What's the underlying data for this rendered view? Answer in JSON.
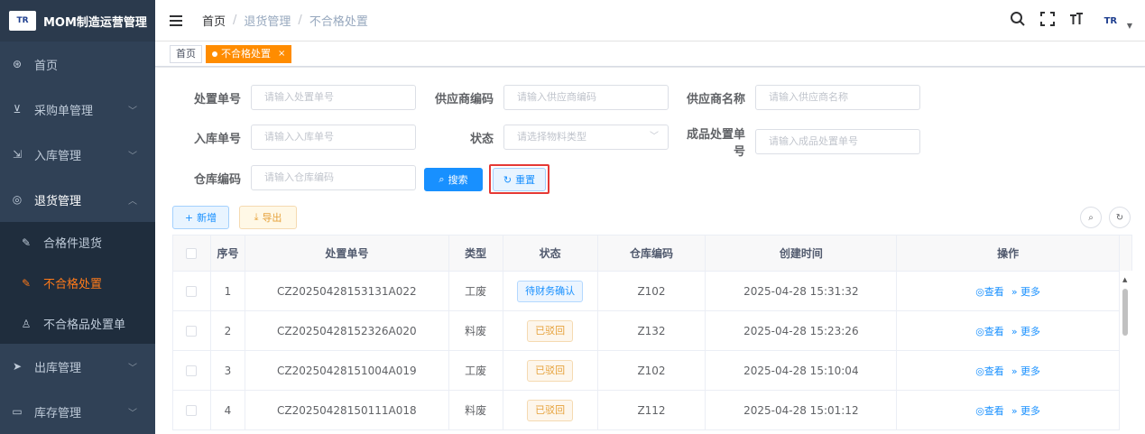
{
  "app": {
    "logo_text": "TR",
    "title": "MOM制造运营管理"
  },
  "sidebar": {
    "items": [
      {
        "label": "首页",
        "icon": "dashboard-icon",
        "glyph": "⊛",
        "has_arrow": false
      },
      {
        "label": "采购单管理",
        "icon": "cart-icon",
        "glyph": "⊻",
        "has_arrow": true
      },
      {
        "label": "入库管理",
        "icon": "import-icon",
        "glyph": "⇲",
        "has_arrow": true
      },
      {
        "label": "退货管理",
        "icon": "return-icon",
        "glyph": "◎",
        "has_arrow": true,
        "open": true
      }
    ],
    "subitems": [
      {
        "label": "合格件退货",
        "icon": "edit-icon",
        "glyph": "✎"
      },
      {
        "label": "不合格处置",
        "icon": "edit-icon",
        "glyph": "✎",
        "active": true
      },
      {
        "label": "不合格品处置单",
        "icon": "user-icon",
        "glyph": "♙"
      }
    ],
    "after": [
      {
        "label": "出库管理",
        "icon": "send-icon",
        "glyph": "➤",
        "has_arrow": true
      },
      {
        "label": "库存管理",
        "icon": "monitor-icon",
        "glyph": "▭",
        "has_arrow": true
      }
    ]
  },
  "header": {
    "breadcrumb": {
      "home": "首页",
      "sep": "/",
      "level1": "退货管理",
      "level2": "不合格处置"
    },
    "logo_text": "TR"
  },
  "tags": {
    "home": "首页",
    "active": "不合格处置",
    "close": "×"
  },
  "form": {
    "dispose_no_label": "处置单号",
    "dispose_no_placeholder": "请输入处置单号",
    "supplier_code_label": "供应商编码",
    "supplier_code_placeholder": "请输入供应商编码",
    "supplier_name_label": "供应商名称",
    "supplier_name_placeholder": "请输入供应商名称",
    "inbound_no_label": "入库单号",
    "inbound_no_placeholder": "请输入入库单号",
    "status_label": "状态",
    "status_placeholder": "请选择物料类型",
    "product_dispose_label": "成品处置单号",
    "product_dispose_placeholder": "请输入成品处置单号",
    "warehouse_label": "仓库编码",
    "warehouse_placeholder": "请输入仓库编码",
    "search_label": "搜索",
    "reset_label": "重置"
  },
  "toolbar": {
    "add_label": "新增",
    "export_label": "导出"
  },
  "table": {
    "headers": [
      "",
      "序号",
      "处置单号",
      "类型",
      "状态",
      "仓库编码",
      "创建时间",
      "操作"
    ],
    "rows": [
      {
        "index": "1",
        "no": "CZ20250428153131A022",
        "type": "工废",
        "status": "待财务确认",
        "status_color": "blue",
        "warehouse": "Z102",
        "created": "2025-04-28 15:31:32"
      },
      {
        "index": "2",
        "no": "CZ20250428152326A020",
        "type": "料废",
        "status": "已驳回",
        "status_color": "orange",
        "warehouse": "Z132",
        "created": "2025-04-28 15:23:26"
      },
      {
        "index": "3",
        "no": "CZ20250428151004A019",
        "type": "工废",
        "status": "已驳回",
        "status_color": "orange",
        "warehouse": "Z102",
        "created": "2025-04-28 15:10:04"
      },
      {
        "index": "4",
        "no": "CZ20250428150111A018",
        "type": "料废",
        "status": "已驳回",
        "status_color": "orange",
        "warehouse": "Z112",
        "created": "2025-04-28 15:01:12"
      }
    ],
    "op_view": "查看",
    "op_more": "更多"
  },
  "colors": {
    "sidebar_bg": "#304156",
    "accent_orange": "#ff8c00",
    "primary_blue": "#1890ff",
    "highlight_red": "#e53935"
  }
}
